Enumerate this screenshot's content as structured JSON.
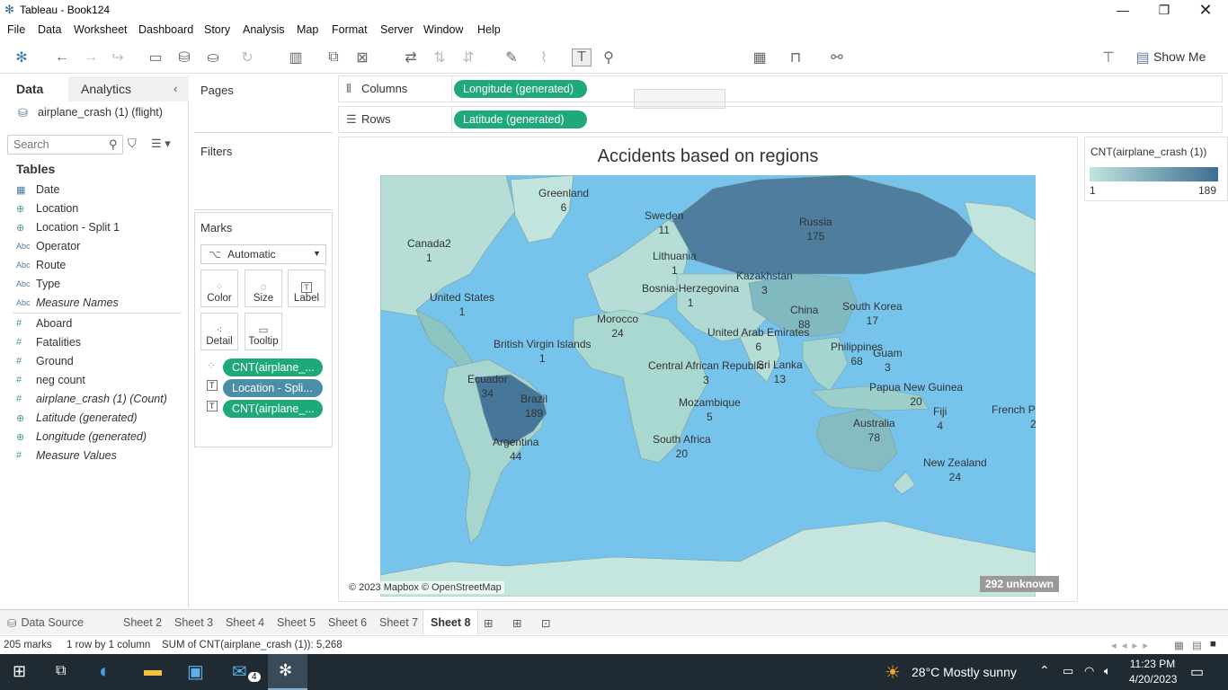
{
  "window": {
    "title": "Tableau - Book124"
  },
  "menu": [
    "File",
    "Data",
    "Worksheet",
    "Dashboard",
    "Story",
    "Analysis",
    "Map",
    "Format",
    "Server",
    "Window",
    "Help"
  ],
  "toolbar": {
    "show_me": "Show Me"
  },
  "data_pane": {
    "tab_data": "Data",
    "tab_analytics": "Analytics",
    "datasource": "airplane_crash (1) (flight)",
    "search_placeholder": "Search",
    "tables_label": "Tables",
    "fields": [
      {
        "name": "Date",
        "icon": "date-icon"
      },
      {
        "name": "Location",
        "icon": "globe-icon"
      },
      {
        "name": "Location - Split 1",
        "icon": "globe-icon"
      },
      {
        "name": "Operator",
        "icon": "abc-icon"
      },
      {
        "name": "Route",
        "icon": "abc-icon"
      },
      {
        "name": "Type",
        "icon": "abc-icon"
      },
      {
        "name": "Measure Names",
        "icon": "abc-icon"
      },
      {
        "name": "Aboard",
        "icon": "hash-icon"
      },
      {
        "name": "Fatalities",
        "icon": "hash-icon"
      },
      {
        "name": "Ground",
        "icon": "hash-icon"
      },
      {
        "name": "neg count",
        "icon": "hash-icon"
      },
      {
        "name": "airplane_crash (1) (Count)",
        "icon": "hash-icon"
      },
      {
        "name": "Latitude (generated)",
        "icon": "globe-icon"
      },
      {
        "name": "Longitude (generated)",
        "icon": "globe-icon"
      },
      {
        "name": "Measure Values",
        "icon": "hash-icon"
      }
    ]
  },
  "cards": {
    "pages": "Pages",
    "filters": "Filters",
    "marks": "Marks",
    "mark_type": "Automatic",
    "mark_buttons": [
      "Color",
      "Size",
      "Label",
      "Detail",
      "Tooltip"
    ],
    "mark_pills": [
      "CNT(airplane_...",
      "Location - Spli...",
      "CNT(airplane_..."
    ]
  },
  "shelves": {
    "columns_label": "Columns",
    "columns_pill": "Longitude (generated)",
    "rows_label": "Rows",
    "rows_pill": "Latitude (generated)"
  },
  "view": {
    "title": "Accidents based on regions",
    "attribution": "© 2023 Mapbox © OpenStreetMap",
    "unknown": "292 unknown",
    "regions": [
      {
        "name": "Greenland",
        "value": "6"
      },
      {
        "name": "Sweden",
        "value": "11"
      },
      {
        "name": "Russia",
        "value": "175"
      },
      {
        "name": "Canada2",
        "value": "1"
      },
      {
        "name": "Lithuania",
        "value": "1"
      },
      {
        "name": "Kazakhstan",
        "value": "3"
      },
      {
        "name": "Bosnia-Herzegovina",
        "value": "1"
      },
      {
        "name": "United States",
        "value": "1"
      },
      {
        "name": "China",
        "value": "88"
      },
      {
        "name": "South Korea",
        "value": "17"
      },
      {
        "name": "Morocco",
        "value": "24"
      },
      {
        "name": "United Arab Emirates",
        "value": "6"
      },
      {
        "name": "British Virgin Islands",
        "value": "1"
      },
      {
        "name": "Philippines",
        "value": "68"
      },
      {
        "name": "Guam",
        "value": "3"
      },
      {
        "name": "Central African Republic",
        "value": "3"
      },
      {
        "name": "Sri Lanka",
        "value": "13"
      },
      {
        "name": "Ecuador",
        "value": "34"
      },
      {
        "name": "Papua New Guinea",
        "value": "20"
      },
      {
        "name": "Brazil",
        "value": "189"
      },
      {
        "name": "Mozambique",
        "value": "5"
      },
      {
        "name": "Fiji",
        "value": "4"
      },
      {
        "name": "French Polynesia",
        "value": "2"
      },
      {
        "name": "Australia",
        "value": "78"
      },
      {
        "name": "Argentina",
        "value": "44"
      },
      {
        "name": "South Africa",
        "value": "20"
      },
      {
        "name": "New Zealand",
        "value": "24"
      }
    ]
  },
  "legend": {
    "title": "CNT(airplane_crash (1))",
    "min": "1",
    "max": "189",
    "color_low": "#c2e4dd",
    "color_high": "#3d6e91"
  },
  "sheets": {
    "data_source": "Data Source",
    "tabs": [
      "Sheet 2",
      "Sheet 3",
      "Sheet 4",
      "Sheet 5",
      "Sheet 6",
      "Sheet 7",
      "Sheet 8"
    ],
    "active": "Sheet 8"
  },
  "status": {
    "marks": "205 marks",
    "rows": "1 row by 1 column",
    "sum": "SUM of CNT(airplane_crash (1)): 5,268"
  },
  "taskbar": {
    "weather": "28°C  Mostly sunny",
    "time": "11:23 PM",
    "date": "4/20/2023",
    "mail_badge": "4"
  }
}
